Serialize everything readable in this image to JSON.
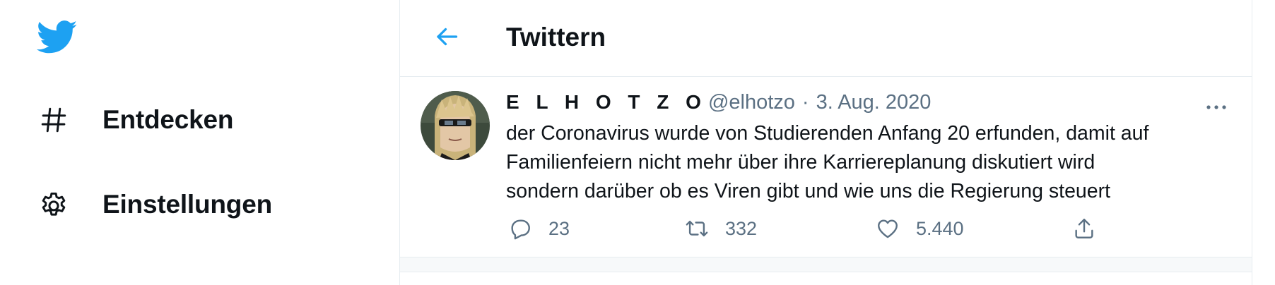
{
  "brand": {
    "color": "#1da1f2",
    "logo_icon": "twitter-bird-icon"
  },
  "nav": {
    "items": [
      {
        "label": "Entdecken",
        "icon": "hashtag-icon"
      },
      {
        "label": "Einstellungen",
        "icon": "gear-icon"
      }
    ]
  },
  "header": {
    "title": "Twittern",
    "back_icon": "back-arrow-icon"
  },
  "tweet": {
    "author_name": "E L H O T Z O",
    "handle": "@elhotzo",
    "separator": "·",
    "date": "3. Aug. 2020",
    "more_icon": "more-dots-icon",
    "text_lines": [
      "der Coronavirus wurde von Studierenden Anfang 20 erfunden, damit auf",
      "Familienfeiern nicht mehr über ihre Karriereplanung diskutiert wird",
      "sondern darüber ob es Viren gibt und wie uns die Regierung steuert"
    ],
    "actions": {
      "reply": {
        "icon": "reply-icon",
        "count": "23"
      },
      "retweet": {
        "icon": "retweet-icon",
        "count": "332"
      },
      "like": {
        "icon": "heart-icon",
        "count": "5.440"
      },
      "share": {
        "icon": "share-icon"
      }
    }
  },
  "colors": {
    "text": "#0f1419",
    "secondary": "#5b7083",
    "border": "#e6ecf0"
  }
}
